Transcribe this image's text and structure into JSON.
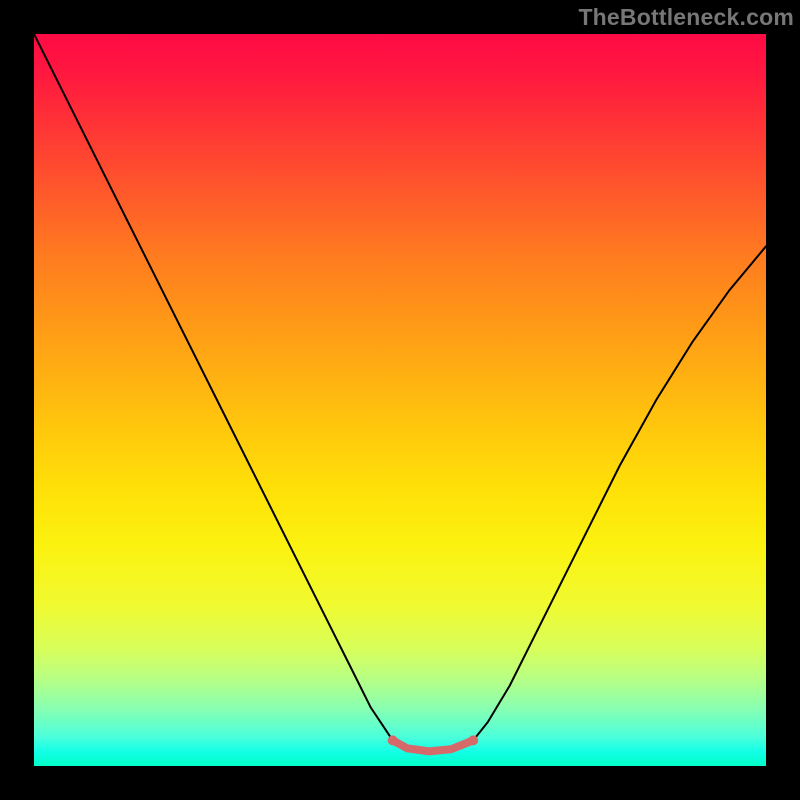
{
  "watermark": "TheBottleneck.com",
  "colors": {
    "curve": "#000000",
    "marker": "#d66a6a",
    "background_black": "#000000"
  },
  "chart_data": {
    "type": "line",
    "title": "",
    "xlabel": "",
    "ylabel": "",
    "xlim": [
      0,
      100
    ],
    "ylim": [
      0,
      100
    ],
    "grid": false,
    "legend": false,
    "description": "Bottleneck curve: V-shaped profile on red-to-green gradient; minimum band marked in salmon",
    "optimal_range": {
      "x_start": 49,
      "x_end": 60,
      "y": 2.3
    },
    "series": [
      {
        "name": "bottleneck",
        "x": [
          0,
          5,
          10,
          15,
          20,
          25,
          30,
          35,
          40,
          43,
          46,
          49,
          51,
          54,
          57,
          60,
          62,
          65,
          70,
          75,
          80,
          85,
          90,
          95,
          100
        ],
        "y": [
          100,
          90,
          80,
          70,
          60,
          50,
          40,
          30,
          20,
          14,
          8,
          3.5,
          2.4,
          2.0,
          2.3,
          3.5,
          6,
          11,
          21,
          31,
          41,
          50,
          58,
          65,
          71
        ]
      }
    ]
  }
}
